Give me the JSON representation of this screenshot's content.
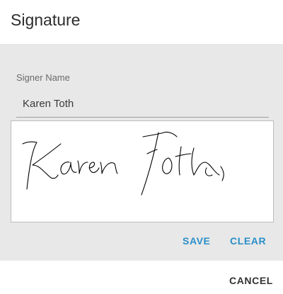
{
  "dialog": {
    "title": "Signature",
    "signer_name_label": "Signer Name",
    "signer_name_value": "Karen Toth",
    "save_label": "SAVE",
    "clear_label": "CLEAR",
    "cancel_label": "CANCEL"
  },
  "colors": {
    "accent": "#2a8fc9",
    "content_bg": "#e8e8e8",
    "ink": "#000000"
  }
}
